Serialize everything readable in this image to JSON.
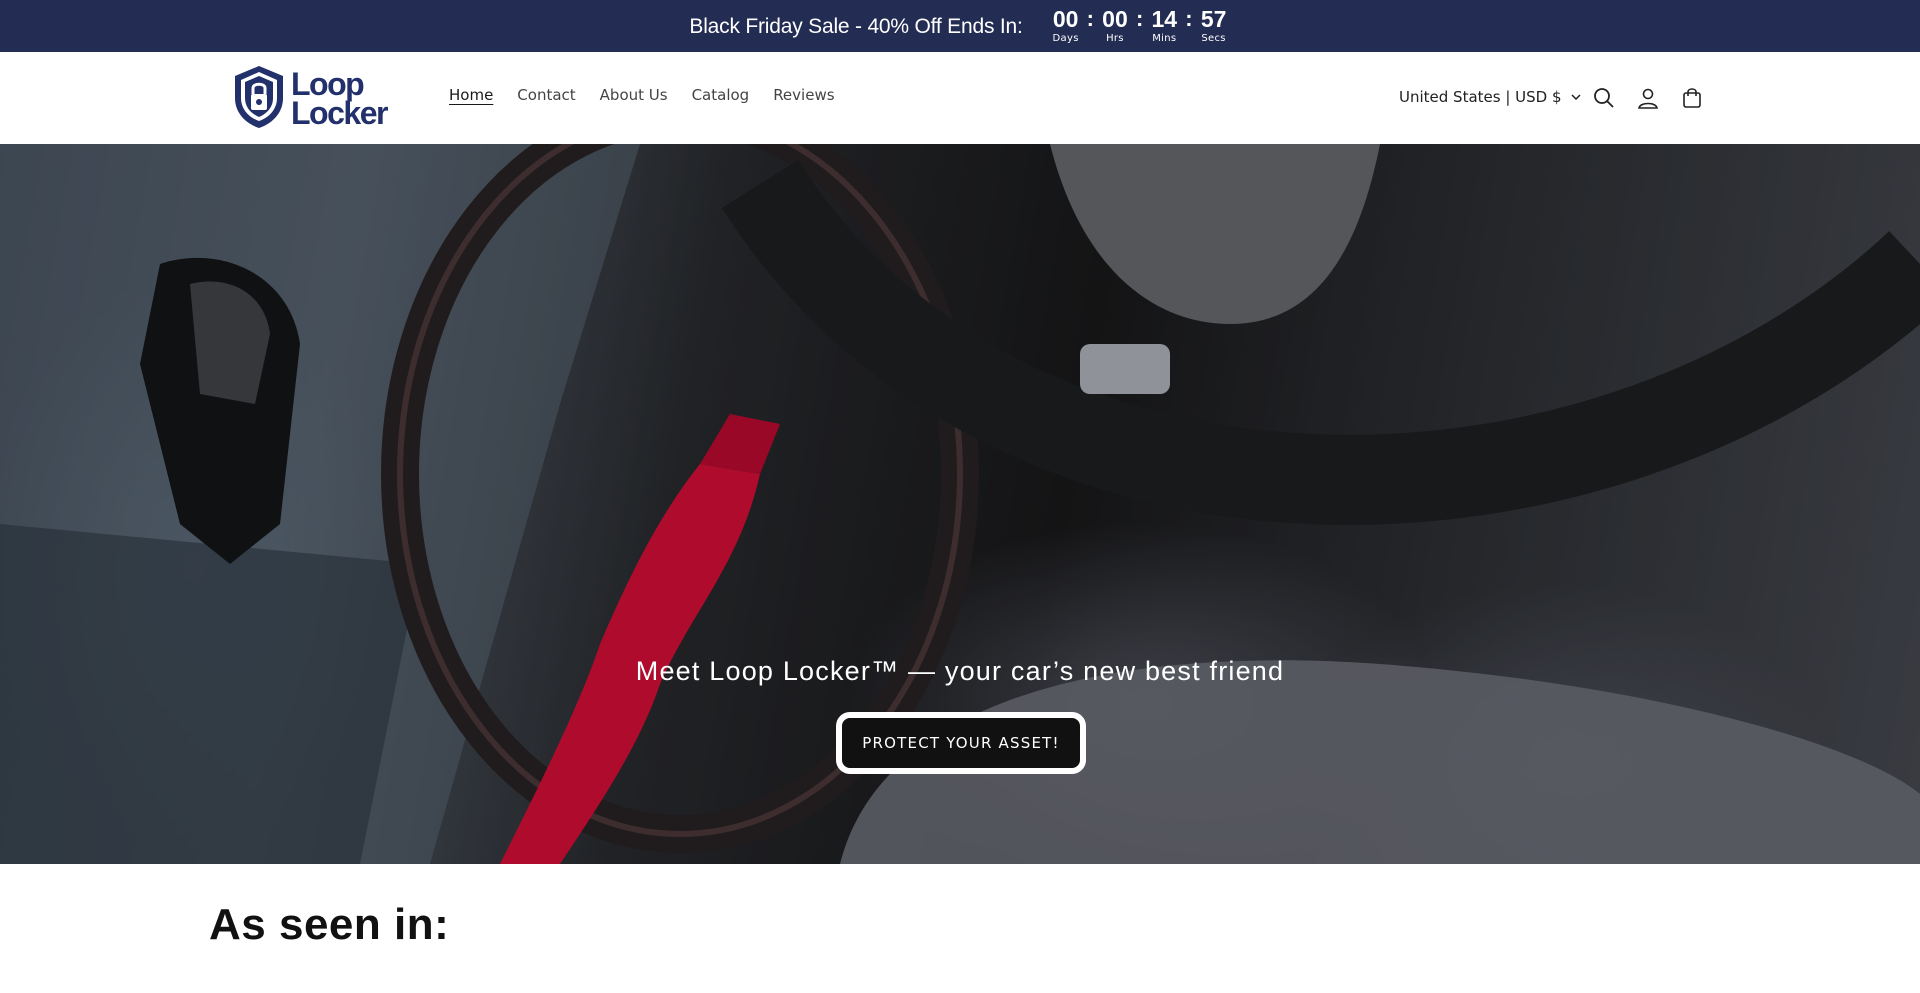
{
  "announcement": {
    "text": "Black Friday Sale - 40% Off Ends In:",
    "timer": [
      {
        "value": "00",
        "label": "Days"
      },
      {
        "value": "00",
        "label": "Hrs"
      },
      {
        "value": "14",
        "label": "Mins"
      },
      {
        "value": "57",
        "label": "Secs"
      }
    ],
    "separator": ":"
  },
  "header": {
    "logo": {
      "line1": "Loop",
      "line2": "Locker",
      "icon": "padlock-icon"
    },
    "nav": [
      {
        "label": "Home",
        "active": true
      },
      {
        "label": "Contact",
        "active": false
      },
      {
        "label": "About Us",
        "active": false
      },
      {
        "label": "Catalog",
        "active": false
      },
      {
        "label": "Reviews",
        "active": false
      }
    ],
    "country_selector": "United States | USD $",
    "icons": [
      "search-icon",
      "account-icon",
      "cart-icon"
    ]
  },
  "hero": {
    "title": "Meet Loop Locker™ — your car’s new best friend",
    "button": "PROTECT YOUR ASSET!"
  },
  "as_seen_in": {
    "heading": "As seen in:"
  },
  "colors": {
    "announcement_bg": "#232c52",
    "brand_blue": "#22306b",
    "accent_red": "#e0103a"
  }
}
